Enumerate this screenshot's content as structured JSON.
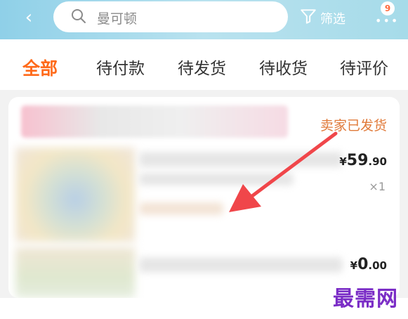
{
  "header": {
    "back_glyph": "‹",
    "search_placeholder": "曼可顿",
    "filter_label": "筛选",
    "more_glyph": "•••",
    "more_badge": "9"
  },
  "tabs": [
    {
      "label": "全部",
      "active": true
    },
    {
      "label": "待付款",
      "active": false
    },
    {
      "label": "待发货",
      "active": false
    },
    {
      "label": "待收货",
      "active": false
    },
    {
      "label": "待评价",
      "active": false
    }
  ],
  "order": {
    "status": "卖家已发货",
    "items": [
      {
        "price_currency": "¥",
        "price_int": "59",
        "price_dec": ".90",
        "quantity": "×1"
      },
      {
        "price_currency": "¥",
        "price_int": "0",
        "price_dec": ".00"
      }
    ]
  },
  "watermark": "最需网",
  "colors": {
    "accent": "#ff6a1a",
    "status": "#e07a3a",
    "arrow": "#f0464a",
    "watermark": "#7a2cc6"
  }
}
